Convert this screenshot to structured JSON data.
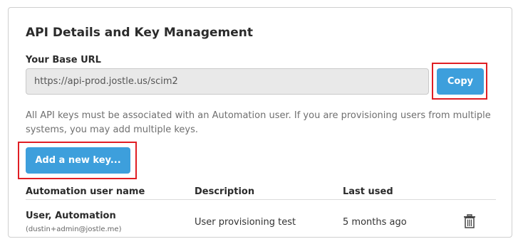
{
  "section": {
    "title": "API Details and Key Management"
  },
  "base_url": {
    "label": "Your Base URL",
    "value": "https://api-prod.jostle.us/scim2",
    "copy_label": "Copy"
  },
  "info_text": "All API keys must be associated with an Automation user. If you are provisioning users from multiple systems, you may add multiple keys.",
  "add_key_label": "Add a new key...",
  "table": {
    "headers": {
      "user": "Automation user name",
      "description": "Description",
      "last_used": "Last used"
    },
    "rows": [
      {
        "user_name": "User, Automation",
        "email": "(dustin+admin@jostle.me)",
        "description": "User provisioning test",
        "last_used": "5 months ago",
        "delete_icon": "trash-icon"
      }
    ]
  },
  "colors": {
    "button": "#3d9fdc",
    "highlight": "#e01e24"
  }
}
